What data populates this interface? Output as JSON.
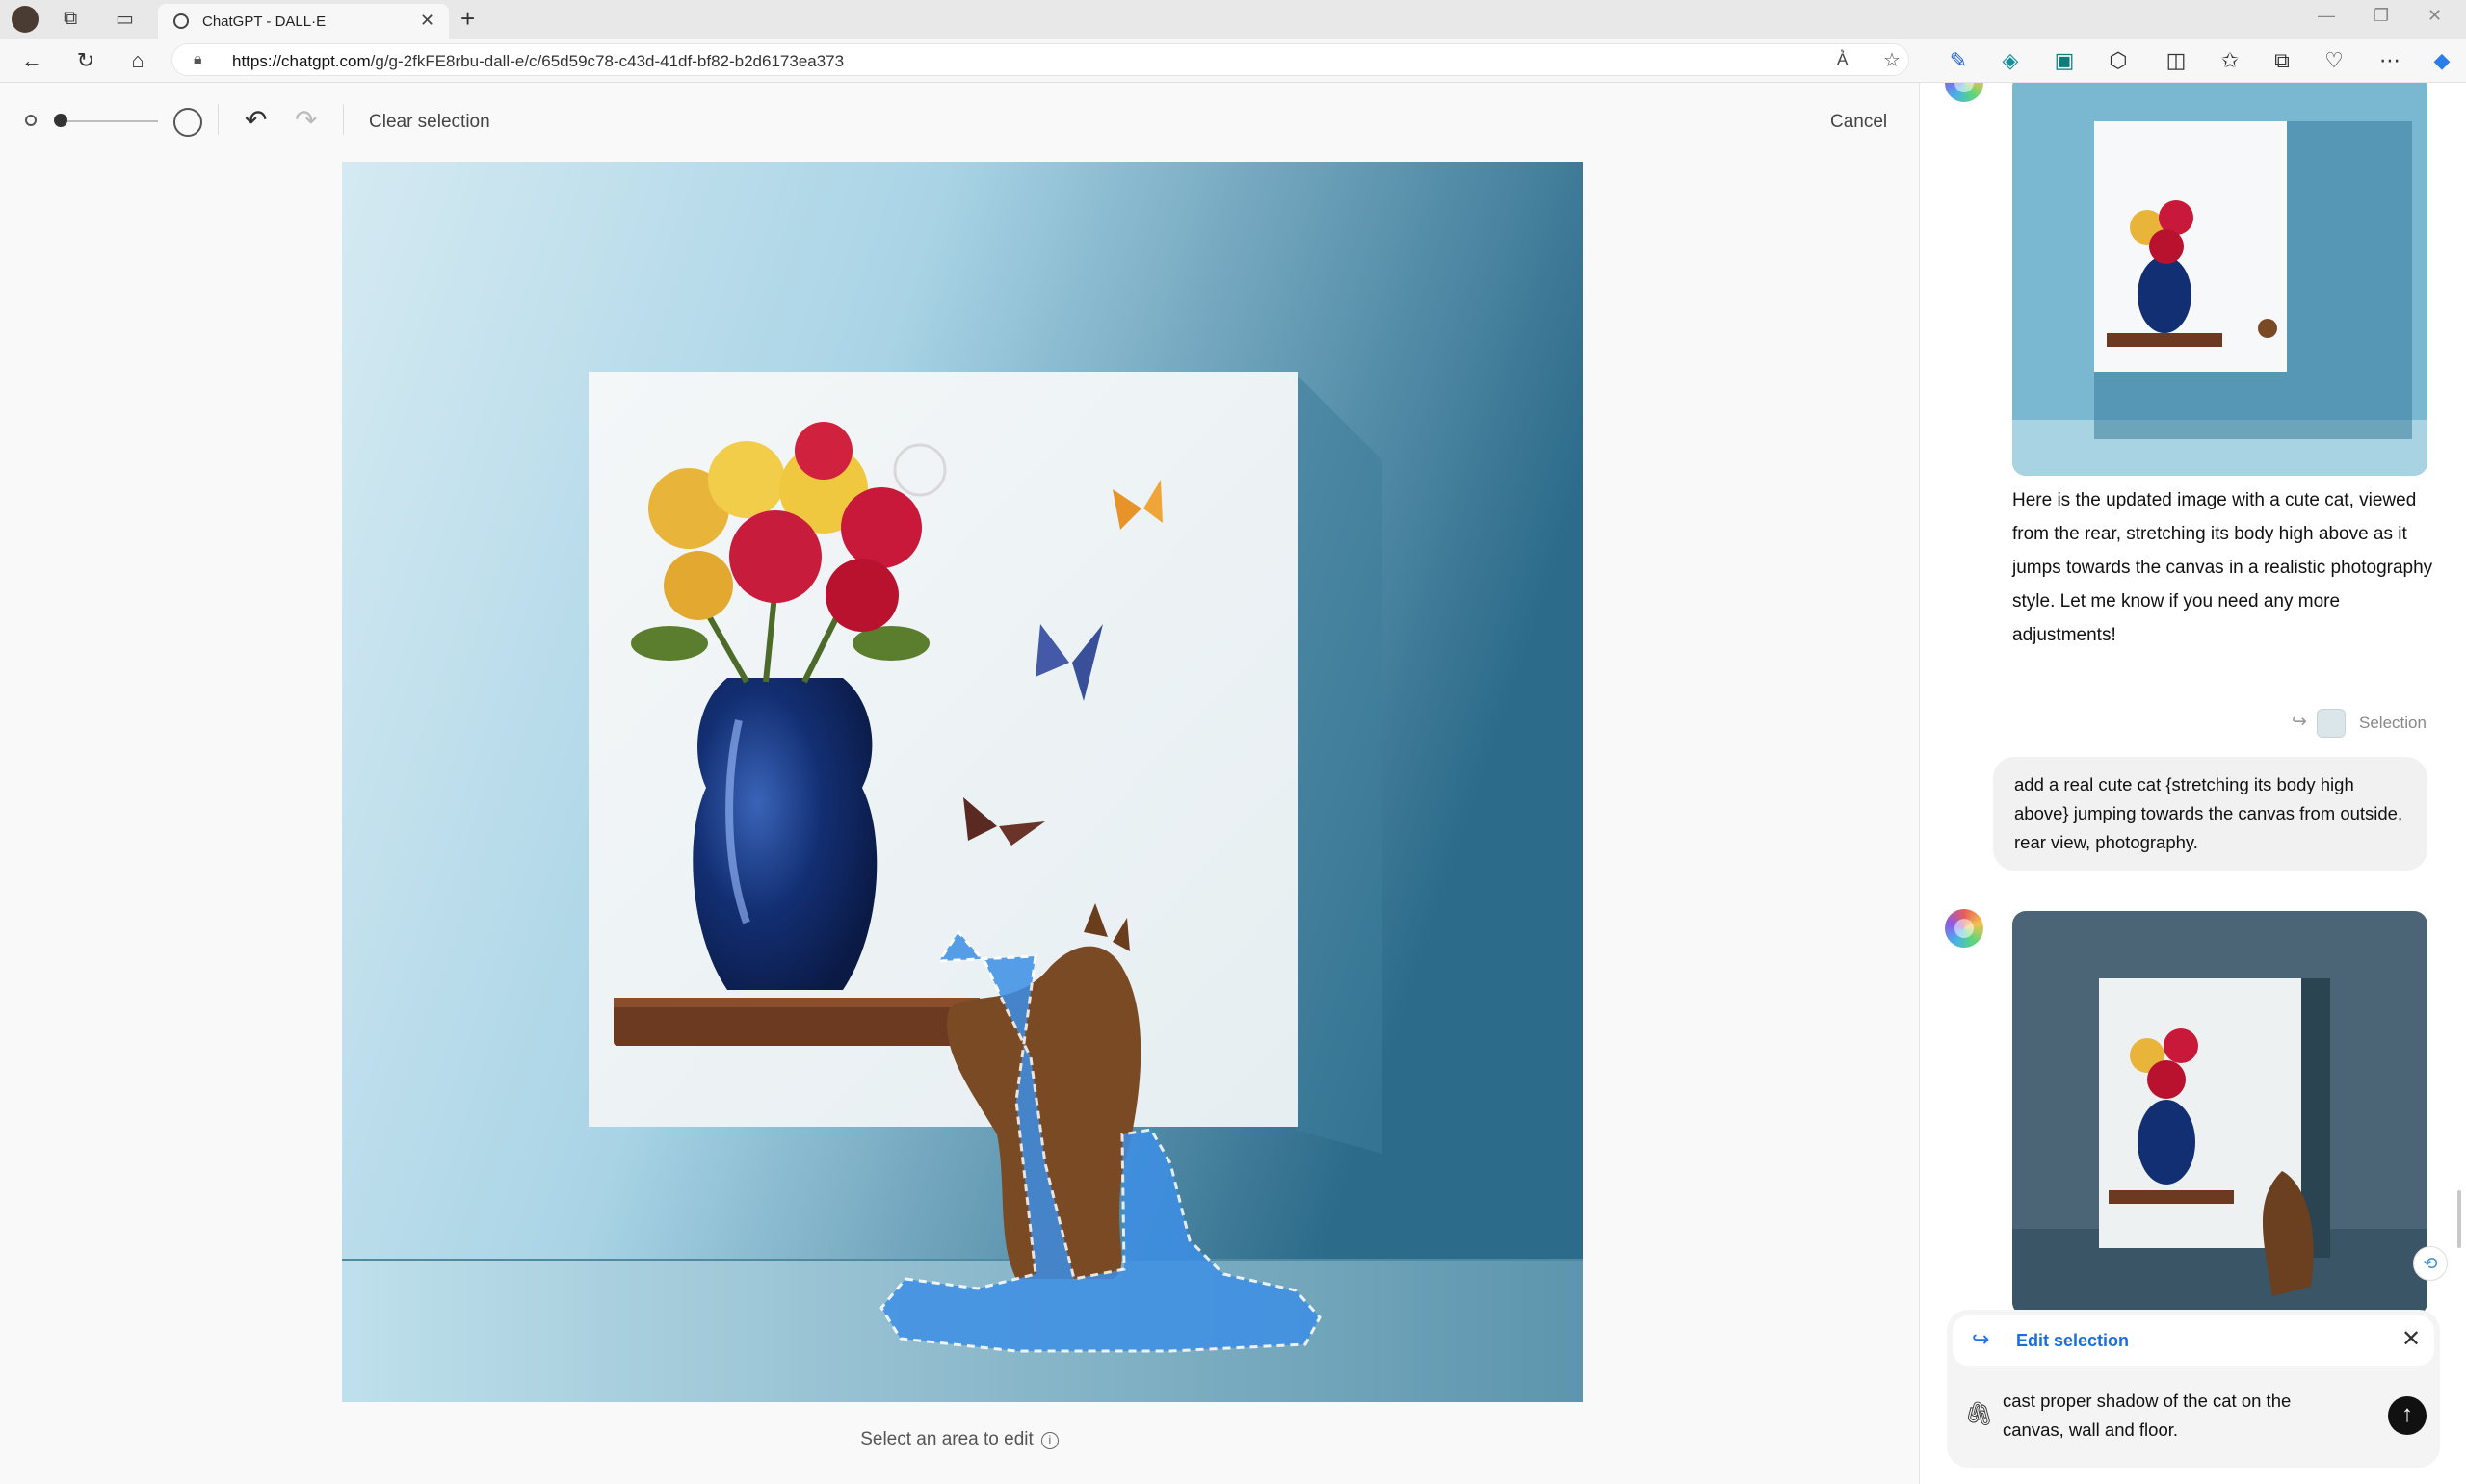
{
  "browser": {
    "tab_title": "ChatGPT - DALL·E",
    "new_tab_icon": "+",
    "url_host": "https://chatgpt.com",
    "url_path": "/g/g-2fkFE8rbu-dall-e/c/65d59c78-c43d-41df-bf82-b2d6173ea373"
  },
  "editor": {
    "clear_selection": "Clear selection",
    "cancel": "Cancel",
    "select_hint": "Select an area to edit",
    "info_icon": "i"
  },
  "chat": {
    "assistant_reply": "Here is the updated image with a cute cat, viewed from the rear, stretching its body high above as it jumps towards the canvas in a realistic photography style. Let me know if you need any more adjustments!",
    "selection_tag": "Selection",
    "user_message": "add a real cute cat {stretching its body high above} jumping towards the canvas from outside, rear view, photography.",
    "compose": {
      "edit_selection_label": "Edit selection",
      "close_icon": "✕",
      "text": "cast proper shadow of the cat on the canvas, wall and floor."
    }
  },
  "colors": {
    "wall_light": "#cfe6f0",
    "wall_dark": "#2f6f8e",
    "selection_mask": "#3d8fe6",
    "link_blue": "#1a6fd8"
  }
}
